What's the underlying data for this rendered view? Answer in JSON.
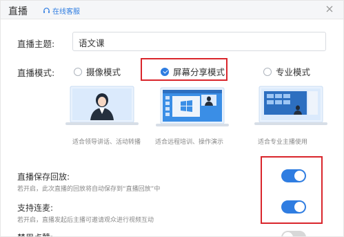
{
  "header": {
    "title": "直播",
    "service_label": "在线客服"
  },
  "topic": {
    "label": "直播主题:",
    "value": "语文课"
  },
  "mode": {
    "label": "直播模式:",
    "options": [
      {
        "label": "摄像模式",
        "caption": "适合领导讲话、活动转播",
        "selected": false
      },
      {
        "label": "屏幕分享模式",
        "caption": "适合远程培训、操作演示",
        "selected": true
      },
      {
        "label": "专业模式",
        "caption": "适合专业主播使用",
        "selected": false
      }
    ]
  },
  "settings": [
    {
      "title": "直播保存回放:",
      "desc": "若开启，此次直播的回放将自动保存到“直播回放”中",
      "enabled": true
    },
    {
      "title": "支持连麦:",
      "desc": "若开启，直播发起后主播可邀请观众进行视频互动",
      "enabled": true
    },
    {
      "title": "禁用点赞:",
      "desc": "",
      "enabled": false
    }
  ],
  "colors": {
    "accent": "#2f7de1",
    "highlight": "#d9252b",
    "toggle_off": "#d8d8d8"
  }
}
